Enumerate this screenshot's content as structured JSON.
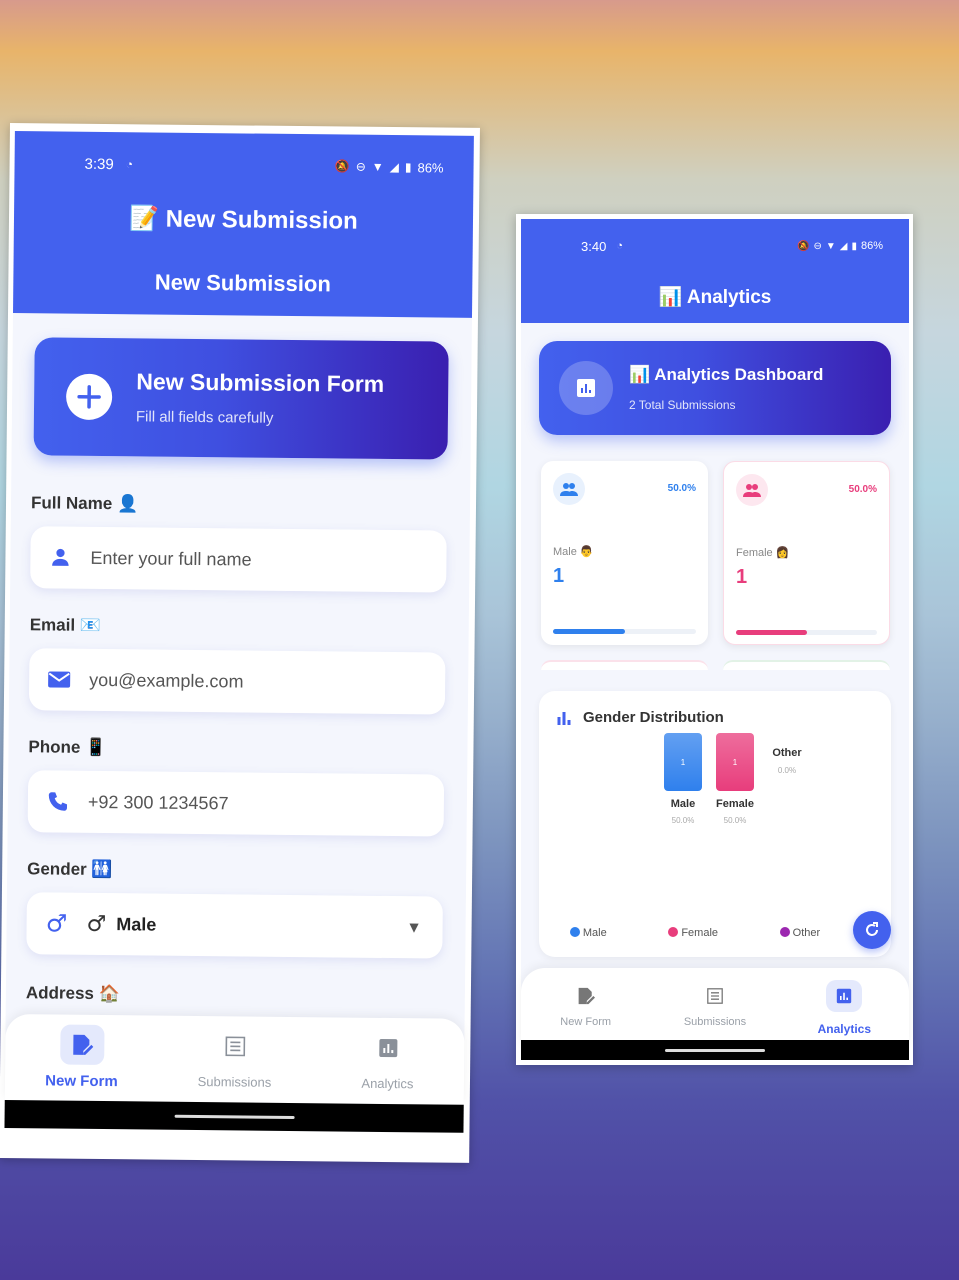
{
  "form_screen": {
    "status": {
      "time": "3:39",
      "battery": "86%"
    },
    "appbar": {
      "title_emoji": "📝",
      "title": "New Submission",
      "subtitle": "New Submission"
    },
    "hero": {
      "title": "New Submission Form",
      "subtitle": "Fill all fields carefully"
    },
    "fields": {
      "full_name": {
        "label": "Full Name",
        "emoji": "👤",
        "placeholder": "Enter your full name"
      },
      "email": {
        "label": "Email",
        "emoji": "📧",
        "placeholder": "you@example.com"
      },
      "phone": {
        "label": "Phone",
        "emoji": "📱",
        "placeholder": "+92 300 1234567"
      },
      "gender": {
        "label": "Gender",
        "emoji": "🚻",
        "value_symbol": "♂",
        "value": "Male"
      },
      "address": {
        "label": "Address",
        "emoji": "🏠"
      }
    },
    "nav": [
      {
        "label": "New Form",
        "icon": "edit-document-icon",
        "active": true
      },
      {
        "label": "Submissions",
        "icon": "list-icon",
        "active": false
      },
      {
        "label": "Analytics",
        "icon": "bar-chart-icon",
        "active": false
      }
    ]
  },
  "analytics_screen": {
    "status": {
      "time": "3:40",
      "battery": "86%"
    },
    "appbar": {
      "title_emoji": "📊",
      "title": "Analytics"
    },
    "hero": {
      "title_emoji": "📊",
      "title": "Analytics Dashboard",
      "subtitle": "2 Total Submissions"
    },
    "stats": [
      {
        "label": "Male",
        "emoji": "👨",
        "value": "1",
        "percent": "50.0%",
        "fraction": 0.5,
        "color": "#2f80ed"
      },
      {
        "label": "Female",
        "emoji": "👩",
        "value": "1",
        "percent": "50.0%",
        "fraction": 0.5,
        "color": "#e83d7c"
      }
    ],
    "distribution": {
      "title": "Gender Distribution",
      "legend": [
        {
          "name": "Male",
          "color": "#2f80ed"
        },
        {
          "name": "Female",
          "color": "#e83d7c"
        },
        {
          "name": "Other",
          "color": "#9c27b0"
        }
      ]
    },
    "nav": [
      {
        "label": "New Form",
        "icon": "edit-document-icon",
        "active": false
      },
      {
        "label": "Submissions",
        "icon": "list-icon",
        "active": false
      },
      {
        "label": "Analytics",
        "icon": "bar-chart-icon",
        "active": true
      }
    ]
  },
  "chart_data": {
    "type": "bar",
    "categories": [
      "Male",
      "Female",
      "Other"
    ],
    "values": [
      1,
      1,
      0
    ],
    "percent_labels": [
      "50.0%",
      "50.0%",
      "0.0%"
    ],
    "colors": [
      "#2f80ed",
      "#e83d7c",
      "#9c27b0"
    ],
    "title": "Gender Distribution",
    "legend": [
      "Male",
      "Female",
      "Other"
    ],
    "legend_position": "bottom"
  }
}
